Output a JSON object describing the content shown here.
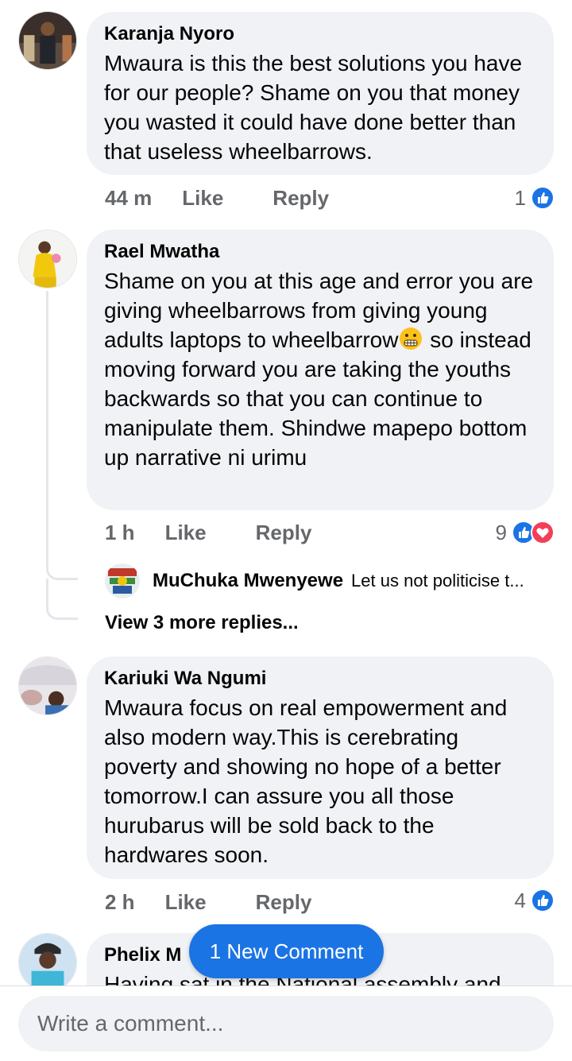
{
  "comments": [
    {
      "author": "Karanja Nyoro",
      "text": "Mwaura is this the best solutions you have for our people? Shame on you that money you wasted it could have done better than that useless wheelbarrows.",
      "time": "44 m",
      "like": "Like",
      "reply": "Reply",
      "reaction_count": "1"
    },
    {
      "author": "Rael Mwatha",
      "text_before_emoji": "Shame on you at this age and error you are giving wheelbarrows from giving young adults laptops to wheelbarrow",
      "text_after_emoji": " so instead moving forward you are taking the youths backwards so that you can continue to manipulate them. Shindwe mapepo bottom up narrative ni urimu",
      "time": "1 h",
      "like": "Like",
      "reply": "Reply",
      "reaction_count": "9",
      "reply_preview": {
        "author": "MuChuka Mwenyewe",
        "text": "Let us not politicise t..."
      },
      "more_replies": "View 3 more replies..."
    },
    {
      "author": "Kariuki Wa Ngumi",
      "text": "Mwaura focus on real empowerment and also modern way.This is cerebrating poverty and showing no hope of a better tomorrow.I can assure you all those hurubarus will be sold back to the hardwares soon.",
      "time": "2 h",
      "like": "Like",
      "reply": "Reply",
      "reaction_count": "4"
    },
    {
      "author_partial": "Phelix M",
      "text_partial": "Having sat in the National assembly and"
    }
  ],
  "new_comment_pill": "1 New Comment",
  "composer": {
    "placeholder": "Write a comment..."
  },
  "colors": {
    "like_blue": "#1b74e4",
    "love_red": "#f33e58",
    "bubble_bg": "#f0f2f5",
    "meta_gray": "#65676b"
  }
}
